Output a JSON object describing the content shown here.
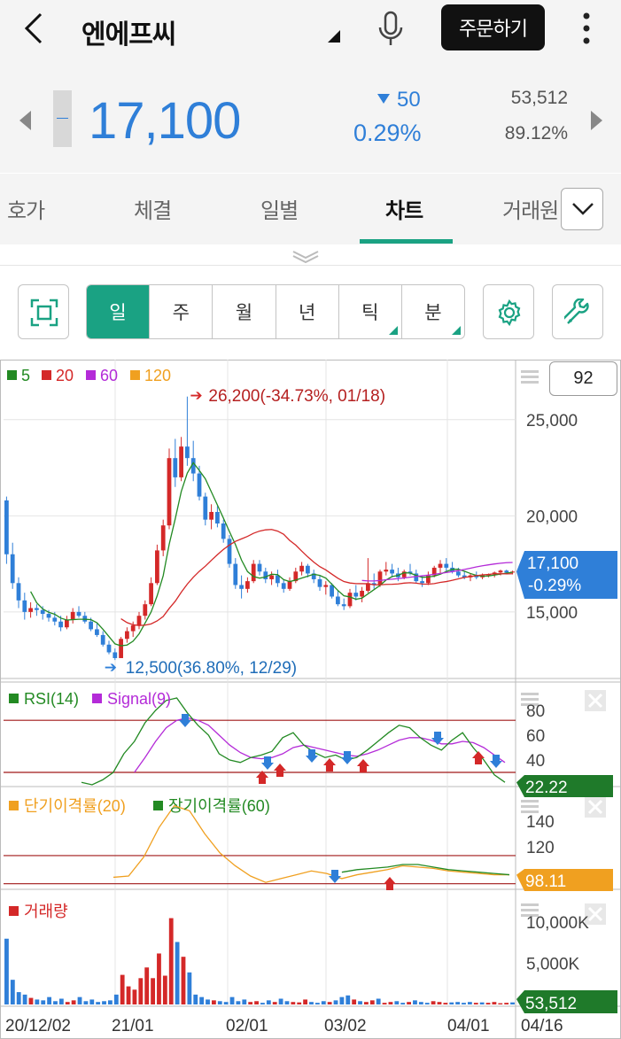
{
  "header": {
    "stock_name": "엔에프씨",
    "order_button": "주문하기",
    "icons": [
      "back-arrow-icon",
      "dropdown-triangle-icon",
      "microphone-icon",
      "more-vertical-icon"
    ]
  },
  "quote": {
    "price": "17,100",
    "change": "50",
    "change_pct": "0.29%",
    "volume": "53,512",
    "volume_ratio": "89.12%",
    "down_color": "#2f7fd8",
    "up_color": "#d42828"
  },
  "tabs": [
    "호가",
    "체결",
    "일별",
    "차트",
    "거래원"
  ],
  "active_tab": "차트",
  "periods": [
    "일",
    "주",
    "월",
    "년",
    "틱",
    "분"
  ],
  "active_period": "일",
  "accent_color": "#1aa283",
  "view_count": "92",
  "chart_data": [
    {
      "type": "candlestick",
      "legend": [
        {
          "name": "5",
          "color": "#238a23"
        },
        {
          "name": "20",
          "color": "#d42828"
        },
        {
          "name": "60",
          "color": "#b42bd8"
        },
        {
          "name": "120",
          "color": "#f0a020"
        }
      ],
      "y_ticks": [
        "25,000",
        "20,000",
        "15,000"
      ],
      "ylim": [
        12000,
        27200
      ],
      "x_ticks": [
        "20/12/02",
        "21/01",
        "02/01",
        "03/02",
        "04/01",
        "04/16"
      ],
      "annotations": {
        "high": "26,200(-34.73%, 01/18)",
        "low": "12,500(36.80%, 12/29)"
      },
      "last_price": "17,100",
      "last_change": "-0.29%",
      "candles": [
        [
          20800,
          21000,
          17500,
          18000
        ],
        [
          18000,
          18600,
          16200,
          16500
        ],
        [
          16500,
          16800,
          15200,
          15600
        ],
        [
          15600,
          16000,
          14600,
          15000
        ],
        [
          15000,
          15500,
          14700,
          15200
        ],
        [
          15200,
          15400,
          14800,
          15100
        ],
        [
          15100,
          15300,
          14600,
          14900
        ],
        [
          14900,
          15100,
          14500,
          14700
        ],
        [
          14700,
          15000,
          14300,
          14500
        ],
        [
          14500,
          14800,
          14000,
          14200
        ],
        [
          14200,
          14800,
          14100,
          14600
        ],
        [
          14600,
          15200,
          14400,
          15000
        ],
        [
          15000,
          15300,
          14700,
          14800
        ],
        [
          14800,
          15000,
          14400,
          14500
        ],
        [
          14500,
          14700,
          14000,
          14100
        ],
        [
          14100,
          14400,
          13700,
          13800
        ],
        [
          13800,
          14000,
          13200,
          13300
        ],
        [
          13300,
          13500,
          12800,
          12900
        ],
        [
          12900,
          13100,
          12500,
          12600
        ],
        [
          12600,
          13700,
          12600,
          13600
        ],
        [
          13600,
          14200,
          13400,
          14000
        ],
        [
          14000,
          14500,
          13700,
          14300
        ],
        [
          14300,
          15000,
          14100,
          14800
        ],
        [
          14800,
          15600,
          14600,
          15400
        ],
        [
          15400,
          16800,
          15300,
          16500
        ],
        [
          16500,
          18500,
          16400,
          18200
        ],
        [
          18200,
          19800,
          17900,
          19500
        ],
        [
          19500,
          23500,
          19300,
          23000
        ],
        [
          23000,
          24000,
          21500,
          22000
        ],
        [
          22000,
          24100,
          21800,
          23600
        ],
        [
          23600,
          26200,
          22600,
          23000
        ],
        [
          23000,
          23900,
          21800,
          22200
        ],
        [
          22200,
          22600,
          20800,
          21000
        ],
        [
          21000,
          21200,
          19500,
          19800
        ],
        [
          19800,
          20600,
          19300,
          20200
        ],
        [
          20200,
          20500,
          19400,
          19600
        ],
        [
          19600,
          19800,
          18600,
          18800
        ],
        [
          18800,
          19000,
          17300,
          17500
        ],
        [
          17500,
          17800,
          16200,
          16400
        ],
        [
          16400,
          16900,
          15700,
          16200
        ],
        [
          16200,
          16800,
          16000,
          16600
        ],
        [
          16600,
          17700,
          16500,
          17500
        ],
        [
          17500,
          17700,
          16900,
          17100
        ],
        [
          17100,
          17300,
          16500,
          16700
        ],
        [
          16700,
          17100,
          16400,
          16900
        ],
        [
          16900,
          17200,
          16300,
          16500
        ],
        [
          16500,
          16700,
          16000,
          16200
        ],
        [
          16200,
          16800,
          16100,
          16600
        ],
        [
          16600,
          17300,
          16500,
          17100
        ],
        [
          17100,
          17600,
          16900,
          17400
        ],
        [
          17400,
          17500,
          16800,
          17000
        ],
        [
          17000,
          17200,
          16500,
          16700
        ],
        [
          16700,
          16900,
          16100,
          16300
        ],
        [
          16300,
          16600,
          15900,
          16400
        ],
        [
          16400,
          16500,
          15700,
          15800
        ],
        [
          15800,
          16100,
          15300,
          15400
        ],
        [
          15400,
          15700,
          15100,
          15300
        ],
        [
          15300,
          16200,
          15200,
          16000
        ],
        [
          16000,
          16400,
          15600,
          15800
        ],
        [
          15800,
          16300,
          15500,
          16100
        ],
        [
          16100,
          17800,
          16000,
          16500
        ],
        [
          16500,
          17000,
          16200,
          16400
        ],
        [
          16400,
          17200,
          16300,
          17100
        ],
        [
          17100,
          17600,
          16900,
          17200
        ],
        [
          17200,
          17500,
          16800,
          17000
        ],
        [
          17000,
          17300,
          16600,
          16800
        ],
        [
          16800,
          17200,
          16700,
          17100
        ],
        [
          17100,
          17500,
          16900,
          17000
        ],
        [
          17000,
          17200,
          16500,
          16600
        ],
        [
          16600,
          16900,
          16300,
          16500
        ],
        [
          16500,
          17100,
          16400,
          16900
        ],
        [
          16900,
          17400,
          16800,
          17300
        ],
        [
          17300,
          17700,
          17000,
          17500
        ],
        [
          17500,
          17800,
          17100,
          17300
        ],
        [
          17300,
          17600,
          17000,
          17100
        ],
        [
          17100,
          17300,
          16800,
          16900
        ],
        [
          16900,
          17100,
          16700,
          16800
        ],
        [
          16800,
          17000,
          16600,
          16900
        ],
        [
          16900,
          17100,
          16700,
          16800
        ],
        [
          16800,
          17000,
          16700,
          16900
        ],
        [
          16900,
          17000,
          16800,
          16950
        ],
        [
          16950,
          17100,
          16800,
          17050
        ],
        [
          17050,
          17200,
          16900,
          17150
        ],
        [
          17150,
          17200,
          16950,
          17050
        ],
        [
          17050,
          17150,
          16950,
          17100
        ]
      ]
    },
    {
      "type": "line",
      "title": "RSI(14) Signal(9)",
      "series": [
        {
          "name": "RSI(14)",
          "color": "#238a23"
        },
        {
          "name": "Signal(9)",
          "color": "#b42bd8"
        }
      ],
      "y_ticks": [
        "80",
        "60",
        "40"
      ],
      "last_value": "22.22",
      "rsi": [
        22,
        20,
        24,
        30,
        45,
        55,
        70,
        80,
        88,
        90,
        78,
        68,
        60,
        45,
        40,
        38,
        42,
        44,
        47,
        58,
        62,
        52,
        46,
        42,
        44,
        40,
        42,
        48,
        55,
        62,
        68,
        66,
        58,
        52,
        48,
        56,
        62,
        50,
        40,
        28,
        22
      ],
      "signal": [
        null,
        null,
        null,
        null,
        null,
        30,
        42,
        55,
        66,
        72,
        74,
        72,
        68,
        60,
        52,
        46,
        42,
        41,
        42,
        45,
        50,
        52,
        50,
        48,
        46,
        44,
        43,
        45,
        48,
        52,
        56,
        58,
        58,
        56,
        53,
        53,
        55,
        54,
        50,
        44,
        38
      ]
    },
    {
      "type": "line",
      "title": "단기이격률(20) 장기이격률(60)",
      "series": [
        {
          "name": "단기이격률(20)",
          "color": "#f0a020"
        },
        {
          "name": "장기이격률(60)",
          "color": "#238a23"
        }
      ],
      "y_ticks": [
        "140",
        "120"
      ],
      "last_value": "98.11",
      "short": [
        96,
        97,
        112,
        135,
        152,
        148,
        130,
        115,
        105,
        97,
        92,
        95,
        98,
        101,
        99,
        95,
        98,
        100,
        102,
        105,
        104,
        103,
        101,
        100,
        99,
        98,
        98
      ],
      "long": [
        null,
        null,
        null,
        null,
        null,
        null,
        null,
        null,
        null,
        null,
        null,
        null,
        null,
        null,
        null,
        100,
        102,
        103,
        104,
        106,
        106,
        104,
        102,
        101,
        100,
        99,
        98
      ]
    },
    {
      "type": "bar",
      "title": "거래량",
      "y_ticks": [
        "10,000K",
        "5,000K"
      ],
      "last_value": "53,512",
      "volumes": [
        8000,
        3000,
        1500,
        1200,
        800,
        600,
        500,
        900,
        400,
        700,
        300,
        500,
        900,
        400,
        600,
        300,
        400,
        500,
        1200,
        3600,
        2200,
        1800,
        3200,
        4500,
        3200,
        6200,
        3500,
        10500,
        7600,
        5800,
        3900,
        1200,
        900,
        600,
        500,
        400,
        300,
        900,
        400,
        600,
        300,
        400,
        200,
        500,
        300,
        700,
        400,
        300,
        250,
        600,
        300,
        200,
        400,
        300,
        500,
        900,
        1100,
        600,
        400,
        300,
        500,
        700,
        200,
        300,
        400,
        200,
        300,
        500,
        300,
        200,
        400,
        300,
        200,
        250,
        300,
        200,
        300,
        200,
        250,
        200,
        300,
        150,
        200,
        250
      ]
    }
  ]
}
